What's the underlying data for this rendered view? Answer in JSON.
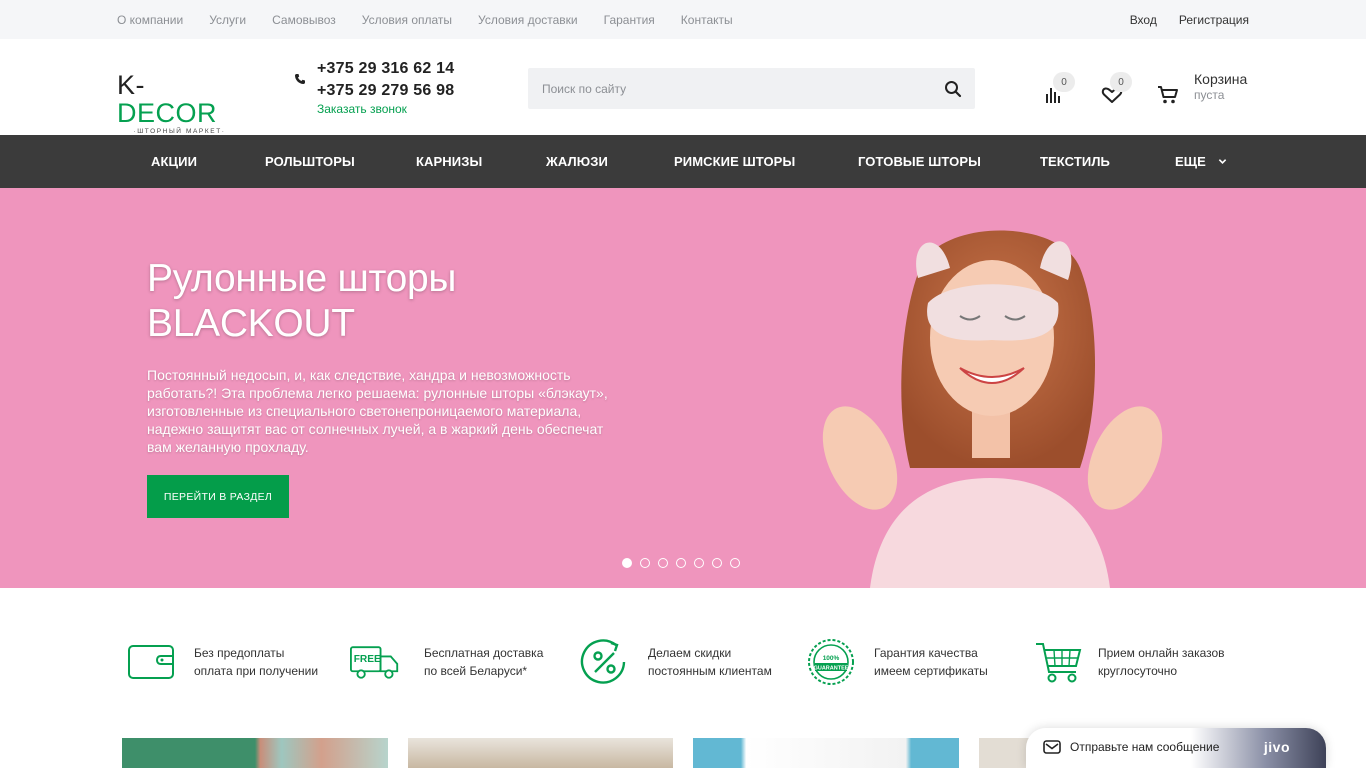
{
  "topbar": {
    "links": [
      "О компании",
      "Услуги",
      "Самовывоз",
      "Условия оплаты",
      "Условия доставки",
      "Гарантия",
      "Контакты"
    ],
    "login": "Вход",
    "register": "Регистрация"
  },
  "header": {
    "logo_main_left": "K-",
    "logo_main_right": "DECOR",
    "logo_sub": "·ШТОРНЫЙ МАРКЕТ·",
    "phone1": "+375 29 316 62 14",
    "phone2": "+375 29 279 56 98",
    "callback": "Заказать звонок",
    "search_placeholder": "Поиск по сайту",
    "compare_count": "0",
    "favorites_count": "0",
    "cart_title": "Корзина",
    "cart_status": "пуста"
  },
  "nav": {
    "items": [
      "АКЦИИ",
      "РОЛЬШТОРЫ",
      "КАРНИЗЫ",
      "ЖАЛЮЗИ",
      "РИМСКИЕ ШТОРЫ",
      "ГОТОВЫЕ ШТОРЫ",
      "ТЕКСТИЛЬ",
      "ЕЩЕ"
    ]
  },
  "hero": {
    "title_line1": "Рулонные шторы",
    "title_line2": "BLACKOUT",
    "description": "Постоянный недосып, и, как следствие, хандра и невозможность работать?!  Эта проблема легко решаема: рулонные шторы «блэкаут», изготовленные из специального светонепроницаемого материала, надежно защитят вас от солнечных лучей, а в жаркий день обеспечат вам желанную прохладу.",
    "cta": "ПЕРЕЙТИ В РАЗДЕЛ",
    "slides_total": 7,
    "active_slide": 1,
    "bg_color": "#ef95bd"
  },
  "features": [
    {
      "icon": "wallet-icon",
      "line1": "Без предоплаты",
      "line2": "оплата при получении"
    },
    {
      "icon": "free-delivery-truck-icon",
      "line1": "Бесплатная доставка",
      "line2": "по всей Беларуси*",
      "badge": "FREE"
    },
    {
      "icon": "percent-icon",
      "line1": "Делаем скидки",
      "line2": "постоянным клиентам"
    },
    {
      "icon": "guarantee-seal-icon",
      "line1": "Гарантия качества",
      "line2": "имеем сертификаты",
      "badge": "100% GUARANTEE"
    },
    {
      "icon": "shopping-cart-icon",
      "line1": "Прием онлайн заказов",
      "line2": "круглосуточно"
    }
  ],
  "chat": {
    "message": "Отправьте нам сообщение",
    "brand": "jivo"
  },
  "colors": {
    "accent": "#05a050",
    "nav_bg": "#3b3b3b",
    "topbar_bg": "#f5f6f8"
  }
}
